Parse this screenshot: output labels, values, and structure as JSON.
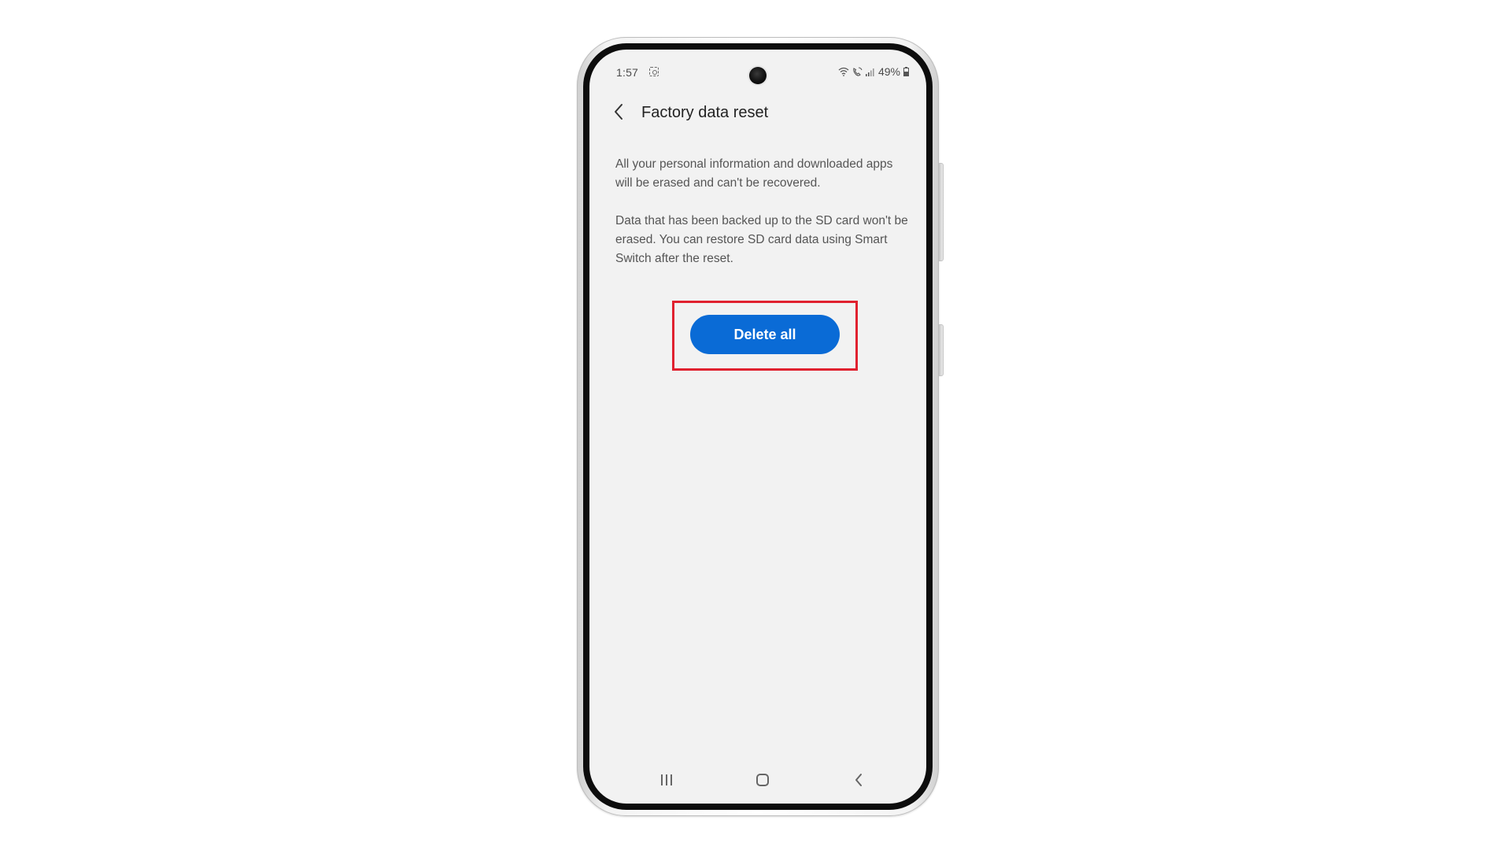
{
  "status_bar": {
    "time": "1:57",
    "battery": "49%"
  },
  "app_bar": {
    "title": "Factory data reset"
  },
  "content": {
    "paragraph_1": "All your personal information and downloaded apps will be erased and can't be recovered.",
    "paragraph_2": "Data that has been backed up to the SD card won't be erased. You can restore SD card data using Smart Switch after the reset."
  },
  "actions": {
    "delete_all_label": "Delete all"
  },
  "icons": {
    "back": "chevron-left-icon",
    "wifi": "wifi-icon",
    "call": "wifi-call-icon",
    "signal": "signal-icon",
    "battery": "battery-icon",
    "nav_recents": "recents-icon",
    "nav_home": "home-icon",
    "nav_back": "back-icon"
  },
  "colors": {
    "accent": "#0a6bd6",
    "highlight": "#e0212f",
    "screen_bg": "#f2f2f2"
  }
}
